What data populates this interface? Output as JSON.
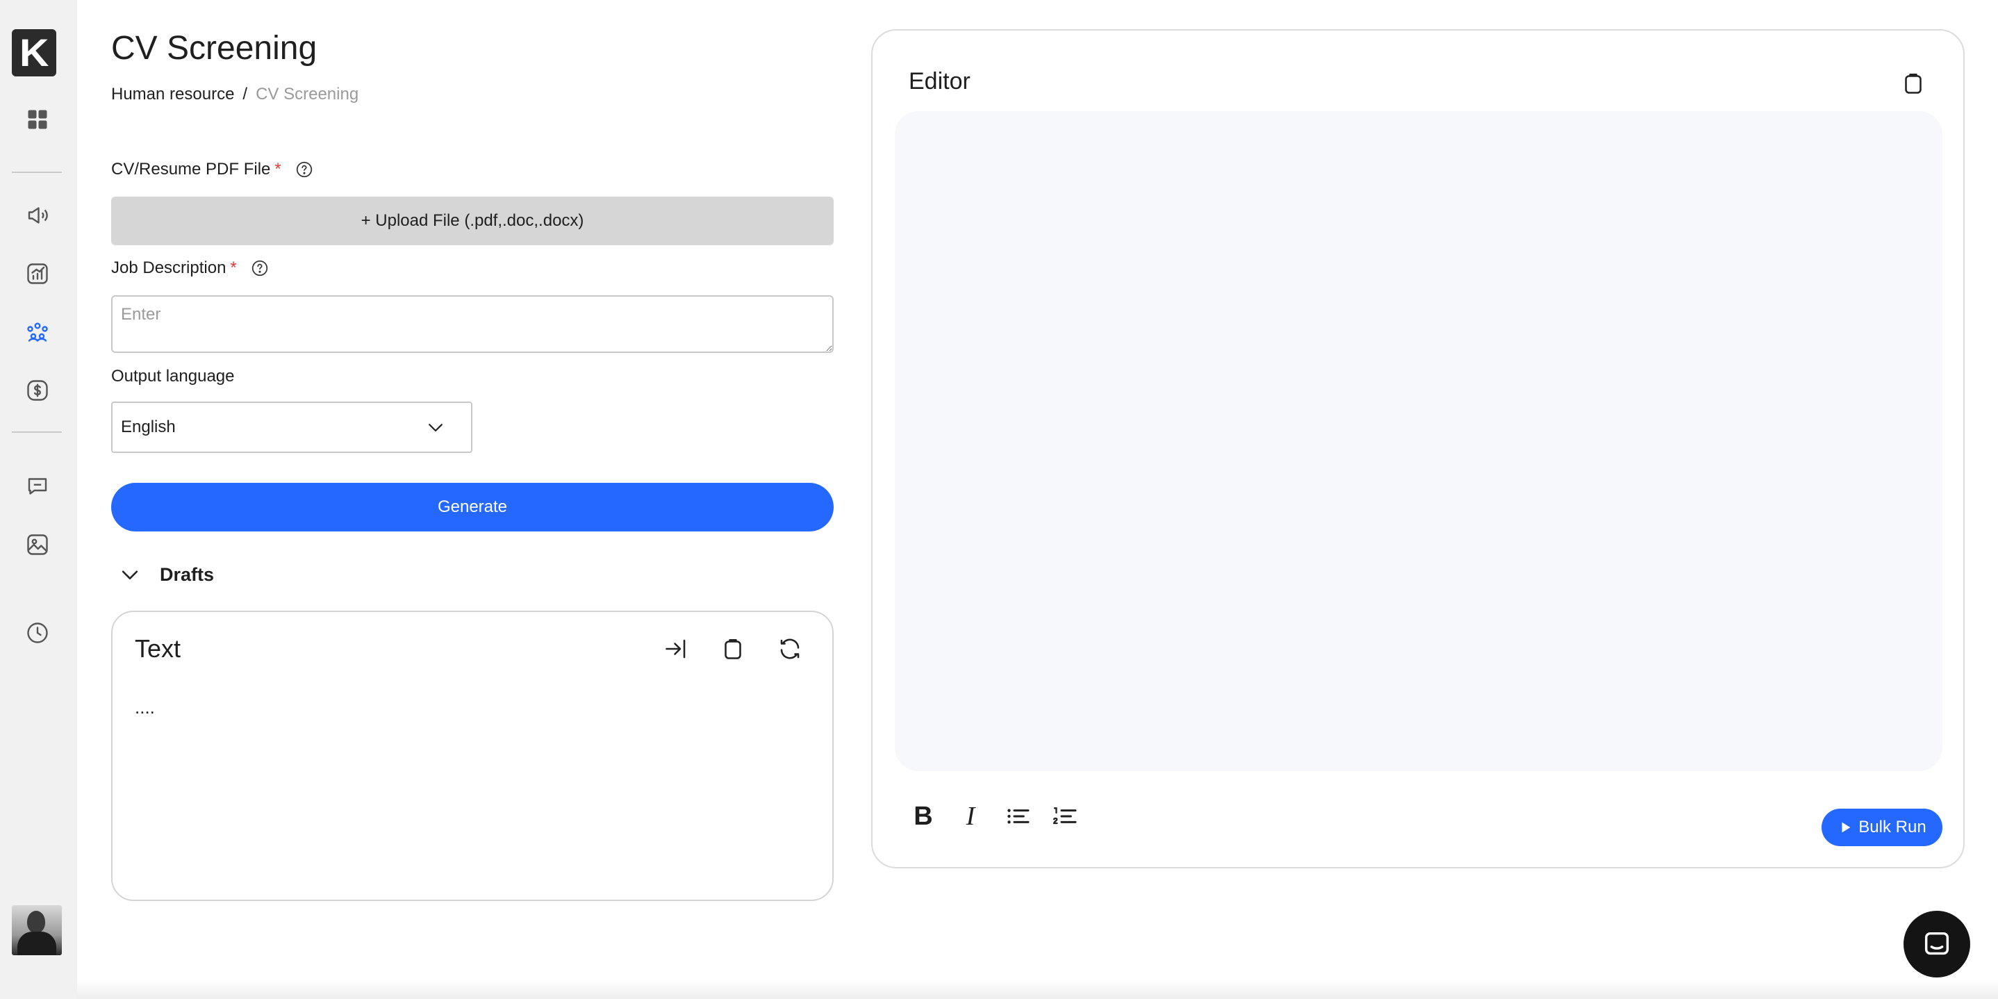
{
  "sidebar": {
    "logo_text": "K",
    "items": [
      {
        "icon": "dashboard-grid-icon",
        "active": false
      },
      {
        "icon": "megaphone-icon",
        "active": false
      },
      {
        "icon": "analytics-chart-icon",
        "active": false
      },
      {
        "icon": "people-group-icon",
        "active": true
      },
      {
        "icon": "dollar-circle-icon",
        "active": false
      },
      {
        "icon": "chat-bubble-icon",
        "active": false
      },
      {
        "icon": "image-icon",
        "active": false
      },
      {
        "icon": "clock-history-icon",
        "active": false
      }
    ],
    "accent_color": "#2468ff"
  },
  "header": {
    "title": "CV Screening",
    "breadcrumb": [
      "Human resource",
      "CV Screening"
    ],
    "breadcrumb_separator": "/"
  },
  "form": {
    "cv_label": "CV/Resume PDF File",
    "required_mark": "*",
    "upload_label": "+ Upload File (.pdf,.doc,.docx)",
    "jd_label": "Job Description",
    "jd_placeholder": "Enter",
    "jd_value": "",
    "output_language_label": "Output language",
    "output_language_value": "English",
    "generate_label": "Generate"
  },
  "drafts": {
    "label": "Drafts",
    "card": {
      "title": "Text",
      "content": "....",
      "actions": [
        "insert-arrow-icon",
        "copy-clipboard-icon",
        "refresh-icon"
      ]
    }
  },
  "editor": {
    "title": "Editor",
    "content": "",
    "formatting": [
      "bold",
      "italic",
      "bullet-list",
      "numbered-list"
    ],
    "bold_glyph": "B",
    "italic_glyph": "I",
    "bulk_run_label": "Bulk Run"
  },
  "colors": {
    "primary": "#2468ff",
    "required": "#e53935",
    "sidebar_bg": "#f1f1f1",
    "editor_bg": "#f7f8fc"
  }
}
